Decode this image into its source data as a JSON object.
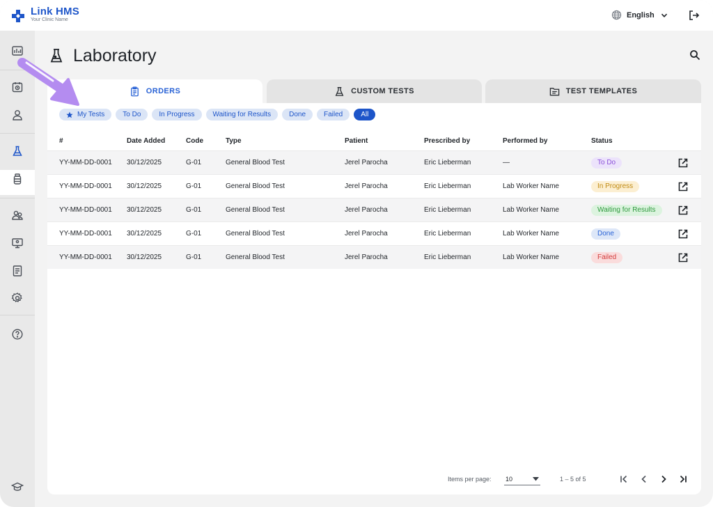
{
  "app": {
    "name": "Link HMS",
    "subtitle": "Your Clinic Name",
    "language": "English"
  },
  "sidebar": {
    "items": [
      {
        "icon": "dashboard-icon"
      },
      {
        "icon": "calendar-icon"
      },
      {
        "icon": "user-icon"
      },
      {
        "icon": "flask-icon",
        "active": true
      },
      {
        "icon": "medicine-bottle-icon"
      },
      {
        "icon": "users-icon"
      },
      {
        "icon": "monitor-icon"
      },
      {
        "icon": "report-icon"
      },
      {
        "icon": "settings-icon"
      },
      {
        "icon": "help-icon"
      },
      {
        "icon": "graduation-cap-icon"
      }
    ]
  },
  "page": {
    "title": "Laboratory"
  },
  "tabs": [
    {
      "label": "ORDERS",
      "active": true
    },
    {
      "label": "CUSTOM TESTS",
      "active": false
    },
    {
      "label": "TEST TEMPLATES",
      "active": false
    }
  ],
  "filters": [
    {
      "label": "My Tests",
      "icon": "star-icon",
      "active": false
    },
    {
      "label": "To Do",
      "active": false
    },
    {
      "label": "In Progress",
      "active": false
    },
    {
      "label": "Waiting for Results",
      "active": false
    },
    {
      "label": "Done",
      "active": false
    },
    {
      "label": "Failed",
      "active": false
    },
    {
      "label": "All",
      "active": true
    }
  ],
  "table": {
    "columns": [
      "#",
      "Date Added",
      "Code",
      "Type",
      "Patient",
      "Prescribed by",
      "Performed by",
      "Status"
    ],
    "rows": [
      {
        "id": "YY-MM-DD-0001",
        "date": "30/12/2025",
        "code": "G-01",
        "type": "General Blood Test",
        "patient": "Jerel Parocha",
        "prescribed_by": "Eric Lieberman",
        "performed_by": "—",
        "status": "To Do"
      },
      {
        "id": "YY-MM-DD-0001",
        "date": "30/12/2025",
        "code": "G-01",
        "type": "General Blood Test",
        "patient": "Jerel Parocha",
        "prescribed_by": "Eric Lieberman",
        "performed_by": "Lab Worker Name",
        "status": "In Progress"
      },
      {
        "id": "YY-MM-DD-0001",
        "date": "30/12/2025",
        "code": "G-01",
        "type": "General Blood Test",
        "patient": "Jerel Parocha",
        "prescribed_by": "Eric Lieberman",
        "performed_by": "Lab Worker Name",
        "status": "Waiting for Results"
      },
      {
        "id": "YY-MM-DD-0001",
        "date": "30/12/2025",
        "code": "G-01",
        "type": "General Blood Test",
        "patient": "Jerel Parocha",
        "prescribed_by": "Eric Lieberman",
        "performed_by": "Lab Worker Name",
        "status": "Done"
      },
      {
        "id": "YY-MM-DD-0001",
        "date": "30/12/2025",
        "code": "G-01",
        "type": "General Blood Test",
        "patient": "Jerel Parocha",
        "prescribed_by": "Eric Lieberman",
        "performed_by": "Lab Worker Name",
        "status": "Failed"
      }
    ]
  },
  "status_colors": {
    "To Do": {
      "bg": "#ece3fb",
      "fg": "#8a4fd8"
    },
    "In Progress": {
      "bg": "#fcefd2",
      "fg": "#c08a12"
    },
    "Waiting for Results": {
      "bg": "#dcf3df",
      "fg": "#2f9a3e"
    },
    "Done": {
      "bg": "#dde7f8",
      "fg": "#2a63d6"
    },
    "Failed": {
      "bg": "#fadcdc",
      "fg": "#d33d3d"
    }
  },
  "pagination": {
    "items_per_page_label": "Items per page:",
    "items_per_page": "10",
    "range": "1 – 5 of 5"
  },
  "colors": {
    "brand": "#1d55c9",
    "annotation_arrow": "#b48cf0"
  }
}
